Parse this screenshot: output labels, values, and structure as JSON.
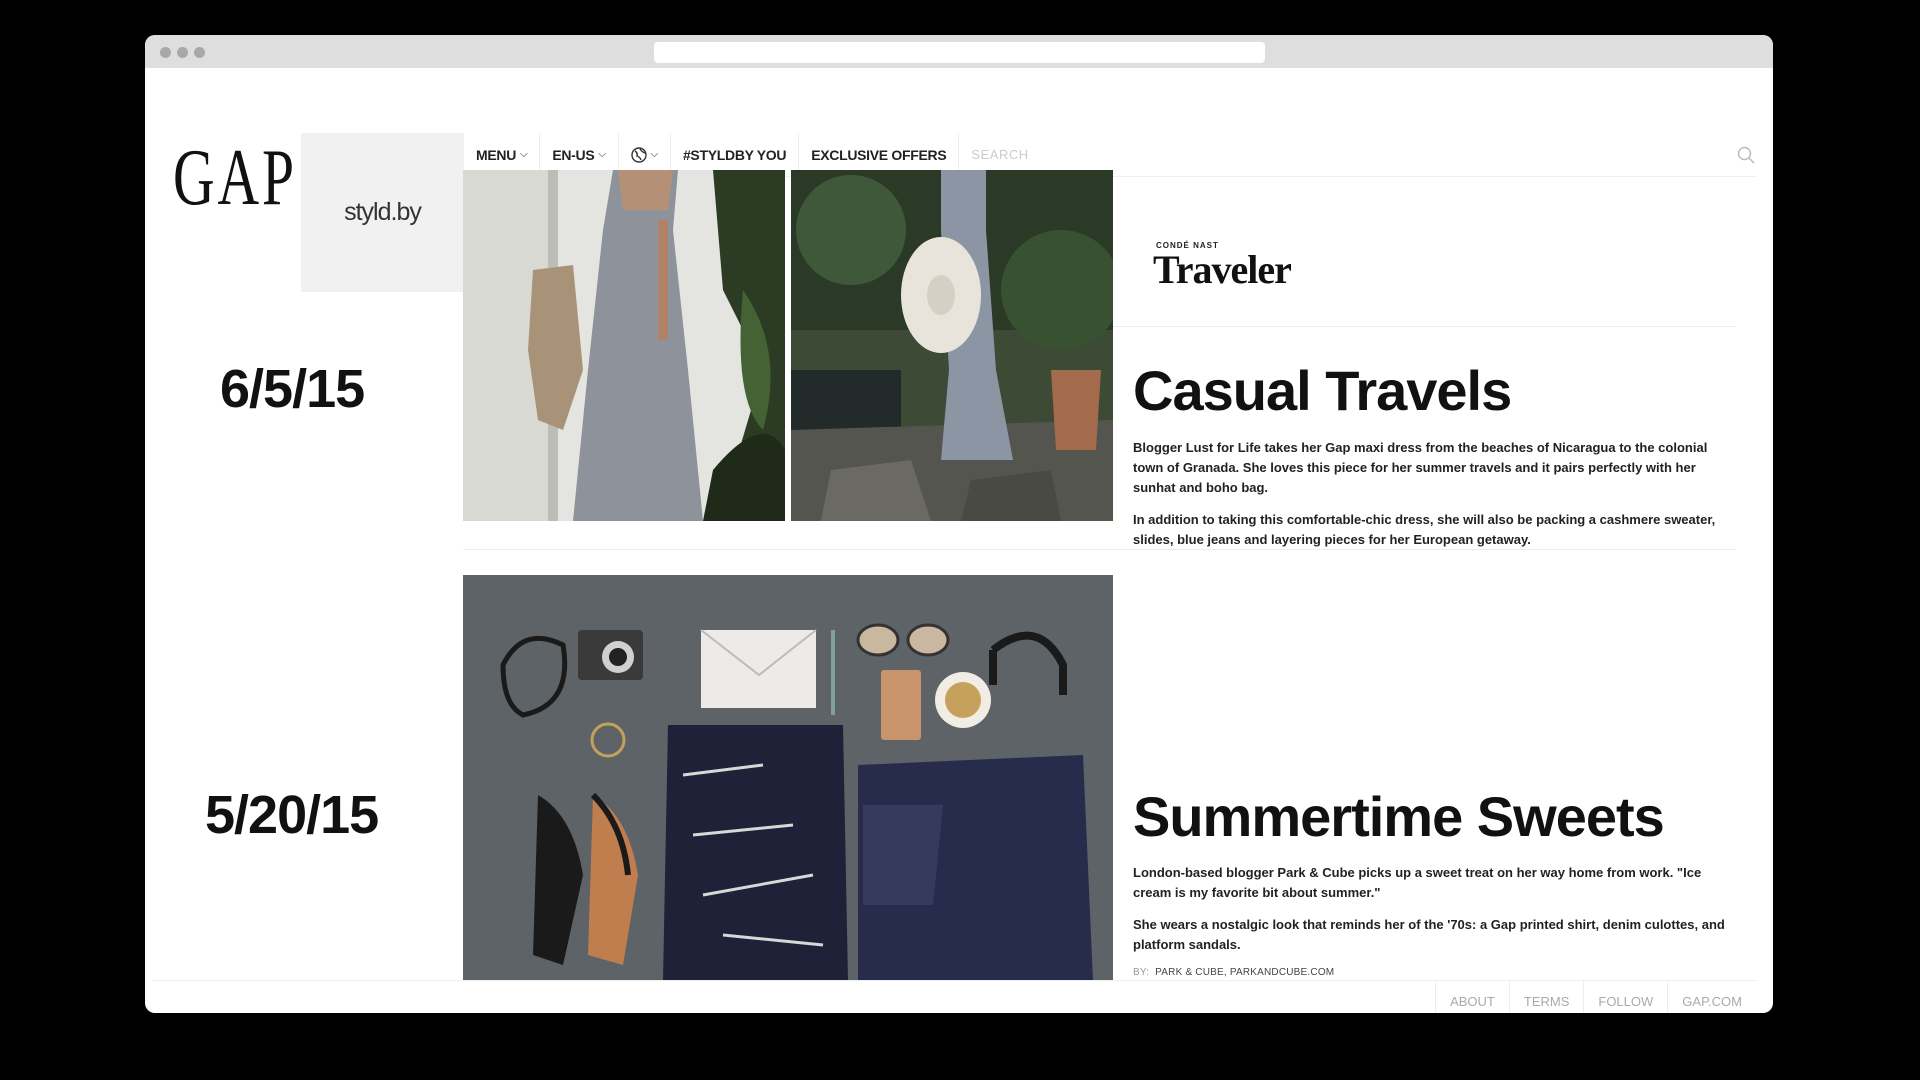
{
  "brand": {
    "logo_text": "GAP",
    "sub_brand": "styld.by"
  },
  "nav": {
    "menu": "MENU",
    "language": "EN-US",
    "hashtag": "#STYLDBY YOU",
    "offers": "EXCLUSIVE OFFERS",
    "search_placeholder": "SEARCH"
  },
  "posts": [
    {
      "date": "6/5/15",
      "publication_small": "CONDÉ NAST",
      "publication": "Traveler",
      "title": "Casual Travels",
      "paragraphs": [
        "Blogger Lust for Life takes her Gap maxi dress from the beaches of Nicaragua to the colonial town of Granada. She loves this piece for her summer travels and it pairs perfectly with her sunhat and boho bag.",
        "In addition to taking this comfortable-chic dress, she will also be packing a cashmere sweater, slides, blue jeans and layering pieces for her European getaway."
      ]
    },
    {
      "date": "5/20/15",
      "title": "Summertime Sweets",
      "paragraphs": [
        "London-based blogger Park & Cube picks up a sweet treat on her way home from work. \"Ice cream is my favorite bit about summer.\"",
        "She wears a nostalgic look that reminds her of the '70s: a Gap printed shirt, denim culottes, and platform sandals."
      ],
      "byline_prefix": "BY:",
      "byline": "PARK & CUBE, PARKANDCUBE.COM"
    }
  ],
  "footer": {
    "about": "ABOUT",
    "terms": "TERMS",
    "follow": "FOLLOW",
    "gapcom": "GAP.COM"
  },
  "colors": {
    "background": "#000000",
    "page": "#ffffff",
    "styld_panel": "#f1f1f1",
    "text": "#111111"
  }
}
